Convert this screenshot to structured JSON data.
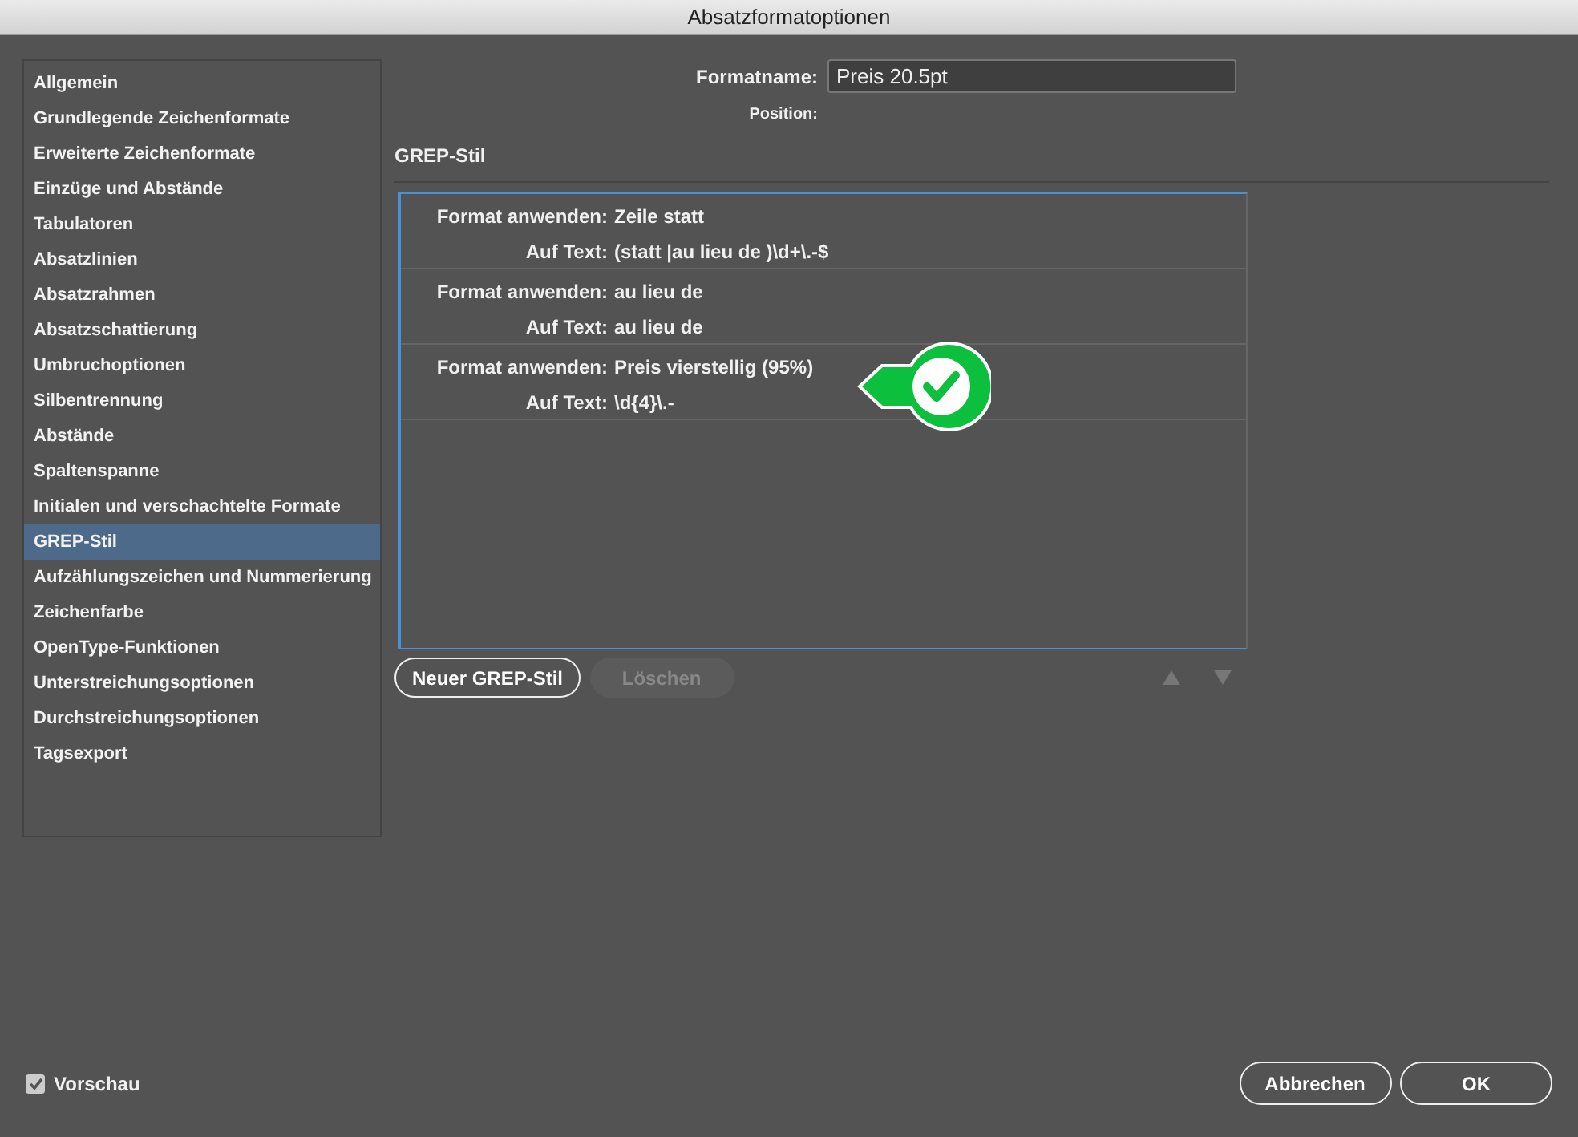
{
  "window": {
    "title": "Absatzformatoptionen"
  },
  "sidebar": {
    "items": [
      {
        "label": "Allgemein",
        "selected": false
      },
      {
        "label": "Grundlegende Zeichenformate",
        "selected": false
      },
      {
        "label": "Erweiterte Zeichenformate",
        "selected": false
      },
      {
        "label": "Einzüge und Abstände",
        "selected": false
      },
      {
        "label": "Tabulatoren",
        "selected": false
      },
      {
        "label": "Absatzlinien",
        "selected": false
      },
      {
        "label": "Absatzrahmen",
        "selected": false
      },
      {
        "label": "Absatzschattierung",
        "selected": false
      },
      {
        "label": "Umbruchoptionen",
        "selected": false
      },
      {
        "label": "Silbentrennung",
        "selected": false
      },
      {
        "label": "Abstände",
        "selected": false
      },
      {
        "label": "Spaltenspanne",
        "selected": false
      },
      {
        "label": "Initialen und verschachtelte Formate",
        "selected": false
      },
      {
        "label": "GREP-Stil",
        "selected": true
      },
      {
        "label": "Aufzählungszeichen und Nummerierung",
        "selected": false
      },
      {
        "label": "Zeichenfarbe",
        "selected": false
      },
      {
        "label": "OpenType-Funktionen",
        "selected": false
      },
      {
        "label": "Unterstreichungsoptionen",
        "selected": false
      },
      {
        "label": "Durchstreichungsoptionen",
        "selected": false
      },
      {
        "label": "Tagsexport",
        "selected": false
      }
    ]
  },
  "format_name": {
    "label": "Formatname:",
    "value": "Preis 20.5pt"
  },
  "position": {
    "label": "Position:"
  },
  "section_title": "GREP-Stil",
  "grep_styles": [
    {
      "style_label": "Format anwenden:",
      "style": "Zeile statt",
      "text_label": "Auf Text:",
      "text": "(statt |au lieu de )\\d+\\.-$",
      "marked": false
    },
    {
      "style_label": "Format anwenden:",
      "style": "au lieu de",
      "text_label": "Auf Text:",
      "text": "au lieu de",
      "marked": false
    },
    {
      "style_label": "Format anwenden:",
      "style": "Preis vierstellig (95%)",
      "text_label": "Auf Text:",
      "text": "\\d{4}\\.-",
      "marked": true
    }
  ],
  "list_buttons": [
    {
      "label": "Neuer GREP-Stil",
      "disabled": false
    },
    {
      "label": "Löschen",
      "disabled": true
    }
  ],
  "move_buttons": [
    {
      "kind": "up",
      "disabled": true
    },
    {
      "kind": "down",
      "disabled": true
    }
  ],
  "preview": {
    "label": "Vorschau",
    "checked": true
  },
  "buttons": [
    {
      "label": "Abbrechen"
    },
    {
      "label": "OK"
    }
  ]
}
